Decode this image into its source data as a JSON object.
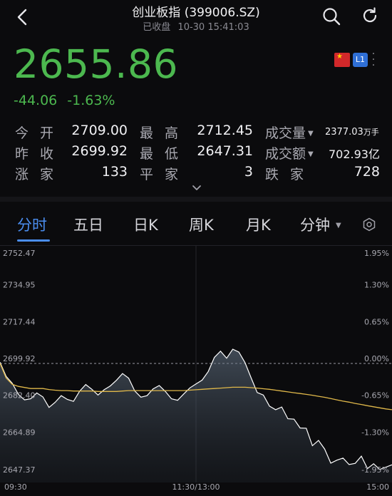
{
  "header": {
    "title": "创业板指 (399006.SZ)",
    "status": "已收盘",
    "datetime": "10-30 15:41:03"
  },
  "quote": {
    "price": "2655.86",
    "change": "-44.06",
    "change_pct": "-1.63%",
    "market_badge": "L1",
    "down_color": "#4cb84f"
  },
  "stats": {
    "open_label": "今开",
    "open_value": "2709.00",
    "high_label": "最高",
    "high_value": "2712.45",
    "volume_label": "成交量",
    "volume_value": "2377.03",
    "volume_unit": "万手",
    "prev_close_label": "昨收",
    "prev_close_value": "2699.92",
    "low_label": "最低",
    "low_value": "2647.31",
    "turnover_label": "成交额",
    "turnover_value": "702.93亿",
    "up_label": "涨家",
    "up_value": "133",
    "flat_label": "平家",
    "flat_value": "3",
    "down_label": "跌家",
    "down_value": "728"
  },
  "tabs": [
    {
      "label": "分时",
      "active": true
    },
    {
      "label": "五日",
      "active": false
    },
    {
      "label": "日K",
      "active": false
    },
    {
      "label": "周K",
      "active": false
    },
    {
      "label": "月K",
      "active": false
    },
    {
      "label": "分钟",
      "active": false
    }
  ],
  "icons": {
    "back": "back-arrow-icon",
    "search": "search-icon",
    "refresh": "refresh-icon",
    "flag": "china-flag-icon",
    "more": "more-vertical-icon",
    "expand": "chevron-down-icon",
    "settings": "hexagon-settings-icon"
  },
  "chart_data": {
    "type": "line",
    "price_axis_labels": [
      "2752.47",
      "2734.95",
      "2717.44",
      "2699.92",
      "2682.40",
      "2664.89",
      "2647.37"
    ],
    "pct_axis_labels": [
      "1.95%",
      "1.30%",
      "0.65%",
      "0.00%",
      "-0.65%",
      "-1.30%",
      "-1.95%"
    ],
    "time_labels": [
      "09:30",
      "11:30/13:00",
      "15:00"
    ],
    "ylim": [
      2647.37,
      2752.47
    ],
    "prev_close": 2699.92,
    "price_line_color": "#ffffff",
    "avg_line_color": "#e0b84a",
    "series": [
      {
        "values": [
          2700.5,
          2693.8,
          2690.5,
          2685.2,
          2682.6,
          2683.1,
          2685.9,
          2684.0,
          2679.0,
          2681.4,
          2684.6,
          2682.8,
          2681.9,
          2686.7,
          2689.9,
          2687.6,
          2684.9,
          2687.4,
          2689.2,
          2691.9,
          2695.1,
          2692.9,
          2686.8,
          2683.9,
          2684.6,
          2687.8,
          2689.4,
          2686.6,
          2683.1,
          2682.4,
          2685.4,
          2688.3,
          2690.2,
          2692.0,
          2696.1,
          2702.8,
          2705.8,
          2702.4,
          2706.7,
          2705.3,
          2700.3,
          2693.1,
          2686.1,
          2684.9,
          2679.6,
          2677.9,
          2679.2,
          2673.6,
          2673.4,
          2669.2,
          2669.1,
          2660.8,
          2663.3,
          2659.2,
          2652.5,
          2653.9,
          2654.9,
          2651.8,
          2652.4,
          2655.8,
          2649.9,
          2652.2,
          2649.5,
          2650.6,
          2651.7
        ]
      },
      {
        "values": [
          2700.0,
          2693.0,
          2690.0,
          2689.0,
          2688.5,
          2688.0,
          2688.0,
          2688.0,
          2687.5,
          2687.2,
          2687.0,
          2687.0,
          2686.8,
          2686.8,
          2686.8,
          2686.8,
          2686.6,
          2686.6,
          2686.6,
          2686.6,
          2686.8,
          2687.0,
          2687.0,
          2687.0,
          2687.0,
          2687.0,
          2687.0,
          2687.0,
          2687.0,
          2687.0,
          2687.0,
          2687.2,
          2687.4,
          2687.6,
          2687.8,
          2688.0,
          2688.2,
          2688.4,
          2688.6,
          2688.6,
          2688.6,
          2688.4,
          2688.2,
          2687.9,
          2687.6,
          2687.2,
          2686.8,
          2686.4,
          2686.0,
          2685.6,
          2685.2,
          2684.8,
          2684.3,
          2683.8,
          2683.2,
          2682.6,
          2682.0,
          2681.5,
          2680.9,
          2680.4,
          2679.8,
          2679.3,
          2678.8,
          2678.3,
          2677.9
        ]
      }
    ]
  }
}
